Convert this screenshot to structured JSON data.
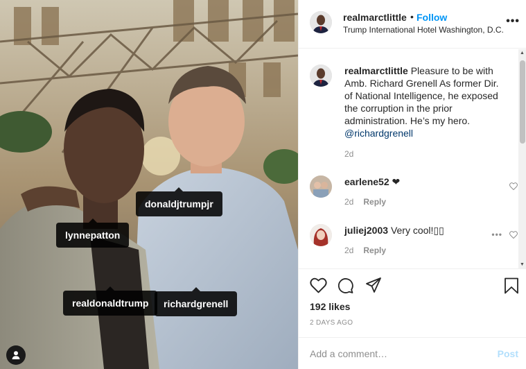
{
  "photo": {
    "tags": [
      "donaldjtrumpjr",
      "lynnepatton",
      "realdonaldtrump",
      "richardgrenell"
    ]
  },
  "header": {
    "username": "realmarctlittle",
    "separator": "•",
    "follow_label": "Follow",
    "location": "Trump International Hotel Washington, D.C.",
    "more_label": "•••"
  },
  "comments": [
    {
      "username": "realmarctlittle",
      "text": "Pleasure to be with Amb. Richard Grenell As former Dir. of National Intelligence, he exposed the corruption in the prior administration. He’s my hero.",
      "mention": "@richardgrenell",
      "age": "2d"
    },
    {
      "username": "earlene52",
      "text": "❤",
      "age": "2d",
      "reply_label": "Reply"
    },
    {
      "username": "juliej2003",
      "text": "Very cool!▯▯",
      "age": "2d",
      "reply_label": "Reply"
    }
  ],
  "actions": {
    "likes": "192 likes",
    "time_ago": "2 DAYS AGO",
    "comment_placeholder": "Add a comment…",
    "post_label": "Post"
  },
  "colors": {
    "accent": "#0095f6",
    "post_disabled": "#b2dffc",
    "muted": "#8e8e8e"
  }
}
